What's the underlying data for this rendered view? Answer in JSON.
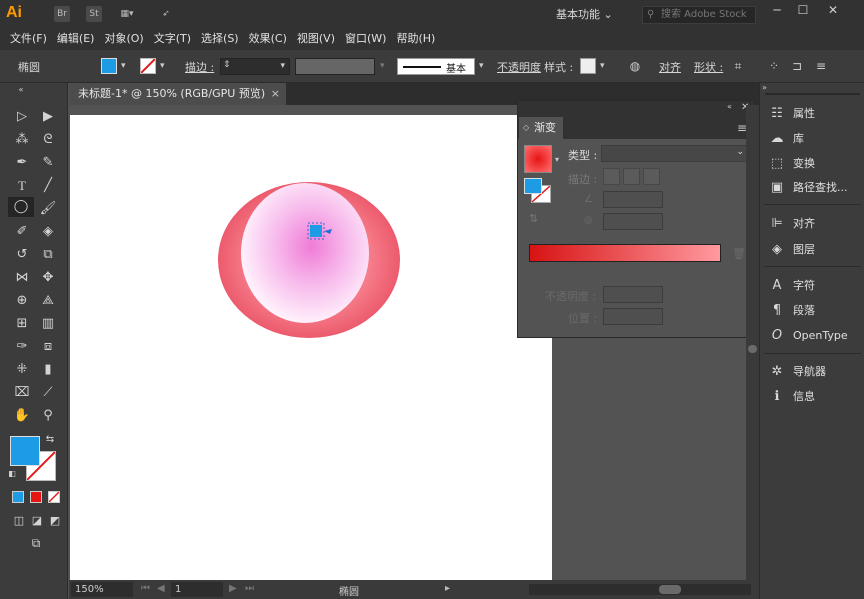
{
  "app": {
    "logo": "Ai",
    "br": "Br",
    "st": "St",
    "workspace": "基本功能",
    "search_placeholder": "搜索 Adobe Stock"
  },
  "window_controls": {
    "minimize": "─",
    "maximize": "☐",
    "close": "✕"
  },
  "menu": [
    "文件(F)",
    "编辑(E)",
    "对象(O)",
    "文字(T)",
    "选择(S)",
    "效果(C)",
    "视图(V)",
    "窗口(W)",
    "帮助(H)"
  ],
  "control_bar": {
    "object_type": "椭圆",
    "stroke_label": "描边 :",
    "stroke_style": "基本",
    "opacity_label": "不透明度",
    "style_label": "样式 :",
    "align_label": "对齐",
    "shape_label": "形状 :"
  },
  "colors": {
    "fill": "#1e9be5",
    "gradient_start": "#e71414",
    "gradient_end": "#ff9aa0"
  },
  "document": {
    "tab_title": "未标题-1* @ 150% (RGB/GPU 预览)",
    "close": "×"
  },
  "gradient_panel": {
    "title": "渐变",
    "type_label": "类型 :",
    "stroke_label": "描边 :",
    "opacity_label": "不透明度 :",
    "location_label": "位置 :"
  },
  "right_dock": [
    {
      "icon": "properties-icon",
      "glyph": "☷",
      "label": "属性"
    },
    {
      "icon": "libraries-icon",
      "glyph": "☁",
      "label": "库"
    },
    {
      "icon": "transform-icon",
      "glyph": "⬚",
      "label": "变换"
    },
    {
      "icon": "pathfinder-icon",
      "glyph": "▣",
      "label": "路径查找..."
    },
    {
      "icon": "align-icon",
      "glyph": "⊫",
      "label": "对齐"
    },
    {
      "icon": "layers-icon",
      "glyph": "◈",
      "label": "图层"
    },
    {
      "icon": "character-icon",
      "glyph": "A",
      "label": "字符"
    },
    {
      "icon": "paragraph-icon",
      "glyph": "¶",
      "label": "段落"
    },
    {
      "icon": "opentype-icon",
      "glyph": "O",
      "label": "OpenType"
    },
    {
      "icon": "navigator-icon",
      "glyph": "✲",
      "label": "导航器"
    },
    {
      "icon": "info-icon",
      "glyph": "ℹ",
      "label": "信息"
    }
  ],
  "status_bar": {
    "zoom": "150%",
    "page": "1",
    "tool": "椭圆"
  }
}
